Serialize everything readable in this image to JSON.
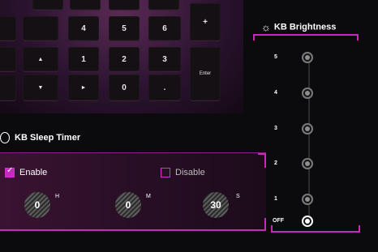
{
  "colors": {
    "accent": "#c42bbd",
    "background": "#0b0b0d"
  },
  "keyboard": {
    "keys": [
      {
        "id": "k4",
        "label": "4"
      },
      {
        "id": "k5",
        "label": "5"
      },
      {
        "id": "k6",
        "label": "6"
      },
      {
        "id": "kplus",
        "label": "+"
      },
      {
        "id": "kup",
        "label": "▲"
      },
      {
        "id": "k1",
        "label": "1"
      },
      {
        "id": "k2",
        "label": "2"
      },
      {
        "id": "k3",
        "label": "3"
      },
      {
        "id": "kenter",
        "label": "Enter"
      },
      {
        "id": "kdown",
        "label": "▼"
      },
      {
        "id": "kright",
        "label": "►"
      },
      {
        "id": "k0",
        "label": "0"
      },
      {
        "id": "kdot",
        "label": "."
      }
    ]
  },
  "sleep_timer": {
    "title": "KB Sleep Timer",
    "enable_label": "Enable",
    "disable_label": "Disable",
    "enabled": true,
    "hours": "0",
    "minutes": "0",
    "seconds": "30",
    "unit_h": "H",
    "unit_m": "M",
    "unit_s": "S"
  },
  "brightness": {
    "title": "KB Brightness",
    "levels": [
      "5",
      "4",
      "3",
      "2",
      "1",
      "OFF"
    ],
    "selected": "OFF"
  }
}
